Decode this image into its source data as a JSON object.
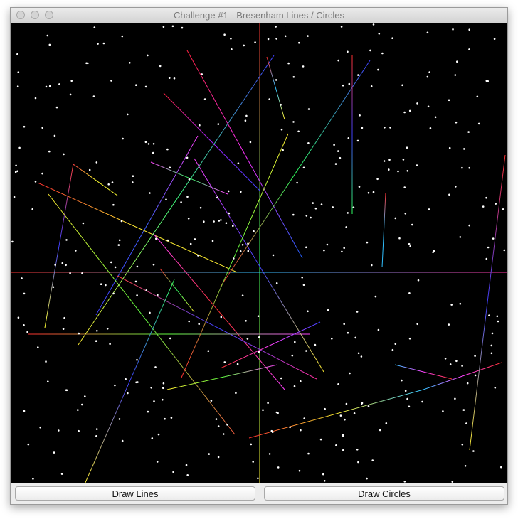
{
  "window": {
    "title": "Challenge #1 - Bresenham Lines / Circles"
  },
  "buttons": {
    "draw_lines": "Draw Lines",
    "draw_circles": "Draw Circles"
  }
}
